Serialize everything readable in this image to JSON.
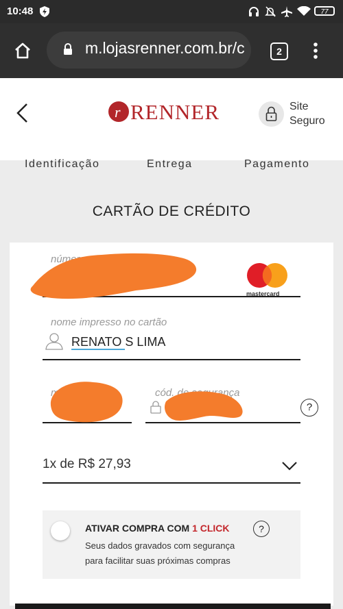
{
  "status_bar": {
    "time": "10:48",
    "battery": "77"
  },
  "browser": {
    "url": "m.lojasrenner.com.br/c",
    "tab_count": "2"
  },
  "header": {
    "logo_text": "RENNER",
    "secure_line1": "Site",
    "secure_line2": "Seguro"
  },
  "steps": [
    "Identificação",
    "Entrega",
    "Pagamento"
  ],
  "section_title": "CARTÃO DE CRÉDITO",
  "form": {
    "card_number_label": "número",
    "card_brand": "mastercard",
    "name_label": "nome impresso no cartão",
    "name_value": "RENATO S LIMA",
    "validity_label": "m",
    "cvv_label": "cód. de segurança",
    "cvv_help": "?",
    "installments": "1x de  R$ 27,93"
  },
  "one_click": {
    "title_prefix": "ATIVAR COMPRA COM ",
    "title_highlight": "1 CLICK",
    "help": "?",
    "description_line1": "Seus dados gravados com segurança",
    "description_line2": "para facilitar suas próximas compras"
  },
  "colors": {
    "brand_red": "#b2262a",
    "highlight_red": "#c3262b",
    "redaction": "#f47c2c",
    "link_underline": "#4aa8d8"
  }
}
